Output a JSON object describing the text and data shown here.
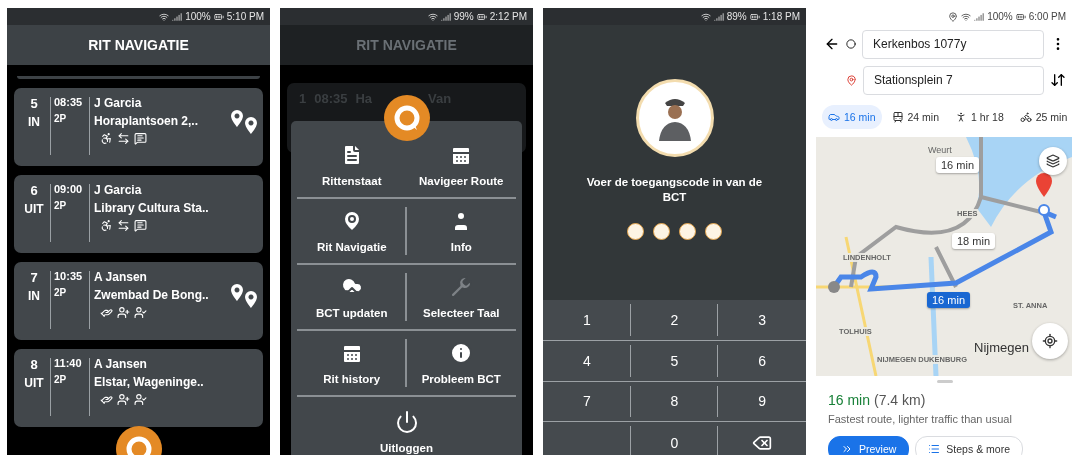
{
  "screens": [
    {
      "kind": "trip_list",
      "status_bar": {
        "battery": "100%",
        "time": "5:10 PM"
      },
      "title": "RIT NAVIGATIE",
      "trips": [
        {
          "number": "5",
          "direction": "IN",
          "time": "08:35",
          "passengers": "2P",
          "name": "J Garcia",
          "address": "Horaplantsoen 2,..",
          "wheelchair": true,
          "escort": true,
          "note": true,
          "assist": false,
          "wheelchair_plus": false,
          "checked_person": false,
          "has_locations": true
        },
        {
          "number": "6",
          "direction": "UIT",
          "time": "09:00",
          "passengers": "2P",
          "name": "J Garcia",
          "address": "Library Cultura Sta..",
          "wheelchair": true,
          "escort": true,
          "note": true,
          "assist": false,
          "wheelchair_plus": false,
          "checked_person": false,
          "has_locations": false
        },
        {
          "number": "7",
          "direction": "IN",
          "time": "10:35",
          "passengers": "2P",
          "name": "A Jansen",
          "address": "Zwembad De Bong..",
          "wheelchair": false,
          "escort": false,
          "note": false,
          "assist": true,
          "wheelchair_plus": true,
          "checked_person": true,
          "has_locations": true
        },
        {
          "number": "8",
          "direction": "UIT",
          "time": "11:40",
          "passengers": "2P",
          "name": "A Jansen",
          "address": "Elstar, Wageninge..",
          "wheelchair": false,
          "escort": false,
          "note": false,
          "assist": true,
          "wheelchair_plus": true,
          "checked_person": true,
          "has_locations": false
        }
      ]
    },
    {
      "kind": "menu",
      "status_bar": {
        "battery": "99%",
        "time": "2:12 PM"
      },
      "title": "RIT NAVIGATIE",
      "background_trip": {
        "number": "1",
        "time": "08:35",
        "name_start": "Ha",
        "name_end": "Van"
      },
      "items": [
        {
          "kind": "report",
          "label": "Rittenstaat",
          "disabled": false
        },
        {
          "kind": "calendar",
          "label": "Navigeer Route",
          "disabled": false
        },
        {
          "kind": "pin",
          "label": "Rit Navigatie",
          "disabled": false
        },
        {
          "kind": "person",
          "label": "Info",
          "disabled": false
        },
        {
          "kind": "cloud",
          "label": "BCT updaten",
          "disabled": false
        },
        {
          "kind": "wrench",
          "label": "Selecteer Taal",
          "disabled": true
        },
        {
          "kind": "calendar",
          "label": "Rit history",
          "disabled": false
        },
        {
          "kind": "info",
          "label": "Probleem BCT",
          "disabled": false
        },
        {
          "kind": "power",
          "label": "Uitloggen",
          "disabled": false
        }
      ]
    },
    {
      "kind": "pin_entry",
      "status_bar": {
        "battery": "89%",
        "time": "1:18 PM"
      },
      "prompt": "Voer de toegangscode in van de BCT",
      "pin_dots": [
        {
          "filled": false
        },
        {
          "filled": false
        },
        {
          "filled": false
        },
        {
          "filled": false
        }
      ],
      "keys": [
        {
          "kind": "digit",
          "label": "1"
        },
        {
          "kind": "digit",
          "label": "2"
        },
        {
          "kind": "digit",
          "label": "3"
        },
        {
          "kind": "digit",
          "label": "4"
        },
        {
          "kind": "digit",
          "label": "5"
        },
        {
          "kind": "digit",
          "label": "6"
        },
        {
          "kind": "digit",
          "label": "7"
        },
        {
          "kind": "digit",
          "label": "8"
        },
        {
          "kind": "digit",
          "label": "9"
        },
        {
          "kind": "blank"
        },
        {
          "kind": "digit",
          "label": "0"
        },
        {
          "kind": "backspace"
        }
      ]
    },
    {
      "kind": "directions",
      "status_bar": {
        "location": true,
        "battery": "100%",
        "time": "6:00 PM"
      },
      "origin": "Kerkenbos 1077y",
      "destination": "Stationsplein 7",
      "modes": [
        {
          "kind": "car",
          "label": "16 min",
          "selected": true
        },
        {
          "kind": "transit",
          "label": "24 min",
          "selected": false
        },
        {
          "kind": "walk",
          "label": "1 hr 18",
          "selected": false
        },
        {
          "kind": "bike",
          "label": "25 min",
          "selected": false
        }
      ],
      "map": {
        "places": [
          {
            "kind": "town",
            "label": "Weurt"
          },
          {
            "kind": "district",
            "label": "HEES"
          },
          {
            "kind": "district",
            "label": "LINDENHOLT"
          },
          {
            "kind": "district",
            "label": "TOLHUIS"
          },
          {
            "kind": "district",
            "label": "NIJMEGEN DUKENBURG"
          },
          {
            "kind": "district",
            "label": "ST. ANNA"
          },
          {
            "kind": "city",
            "label": "Nijmegen"
          }
        ],
        "route_labels": [
          {
            "label": "16 min",
            "selected": false
          },
          {
            "label": "18 min",
            "selected": false
          },
          {
            "label": "16 min",
            "selected": true
          }
        ]
      },
      "summary": {
        "duration": "16 min",
        "distance": "(7.4 km)",
        "note": "Fastest route, lighter traffic than usual"
      },
      "buttons": [
        {
          "kind": "primary",
          "label": "Preview"
        },
        {
          "kind": "secondary",
          "label": "Steps & more"
        }
      ]
    }
  ]
}
